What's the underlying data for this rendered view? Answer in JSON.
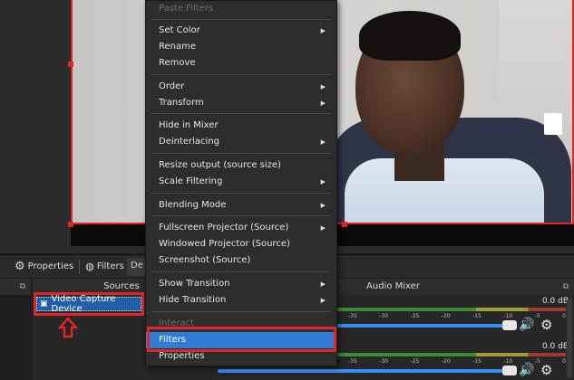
{
  "toolbar": {
    "properties_label": "Properties",
    "filters_label": "Filters",
    "stub_label": "De"
  },
  "dock": {
    "undock_icon": "⧉"
  },
  "sources": {
    "title": "Sources",
    "items": [
      {
        "label": "Video Capture Device",
        "icon": "camera-icon"
      }
    ]
  },
  "mixer": {
    "title": "Audio Mixer",
    "channels": [
      {
        "db": "0.0 dB",
        "fader_percent": 100
      },
      {
        "db": "0.0 dB",
        "fader_percent": 100
      }
    ],
    "ticks": [
      "-35",
      "-30",
      "-25",
      "-20",
      "-15",
      "-10",
      "-5",
      "0"
    ]
  },
  "menu": {
    "items": [
      {
        "label": "Paste Filters",
        "disabled": true
      },
      {
        "label": "Set Color",
        "submenu": true
      },
      {
        "label": "Rename"
      },
      {
        "label": "Remove"
      },
      {
        "label": "Order",
        "submenu": true
      },
      {
        "label": "Transform",
        "submenu": true
      },
      {
        "label": "Hide in Mixer"
      },
      {
        "label": "Deinterlacing",
        "submenu": true
      },
      {
        "label": "Resize output (source size)"
      },
      {
        "label": "Scale Filtering",
        "submenu": true
      },
      {
        "label": "Blending Mode",
        "submenu": true
      },
      {
        "label": "Fullscreen Projector (Source)",
        "submenu": true
      },
      {
        "label": "Windowed Projector (Source)"
      },
      {
        "label": "Screenshot (Source)"
      },
      {
        "label": "Show Transition",
        "submenu": true
      },
      {
        "label": "Hide Transition",
        "submenu": true
      },
      {
        "label": "Interact",
        "disabled": true
      },
      {
        "label": "Filters",
        "active": true
      },
      {
        "label": "Properties"
      }
    ]
  },
  "colors": {
    "accent": "#2f7bd6",
    "highlight_red": "#e0262b"
  }
}
